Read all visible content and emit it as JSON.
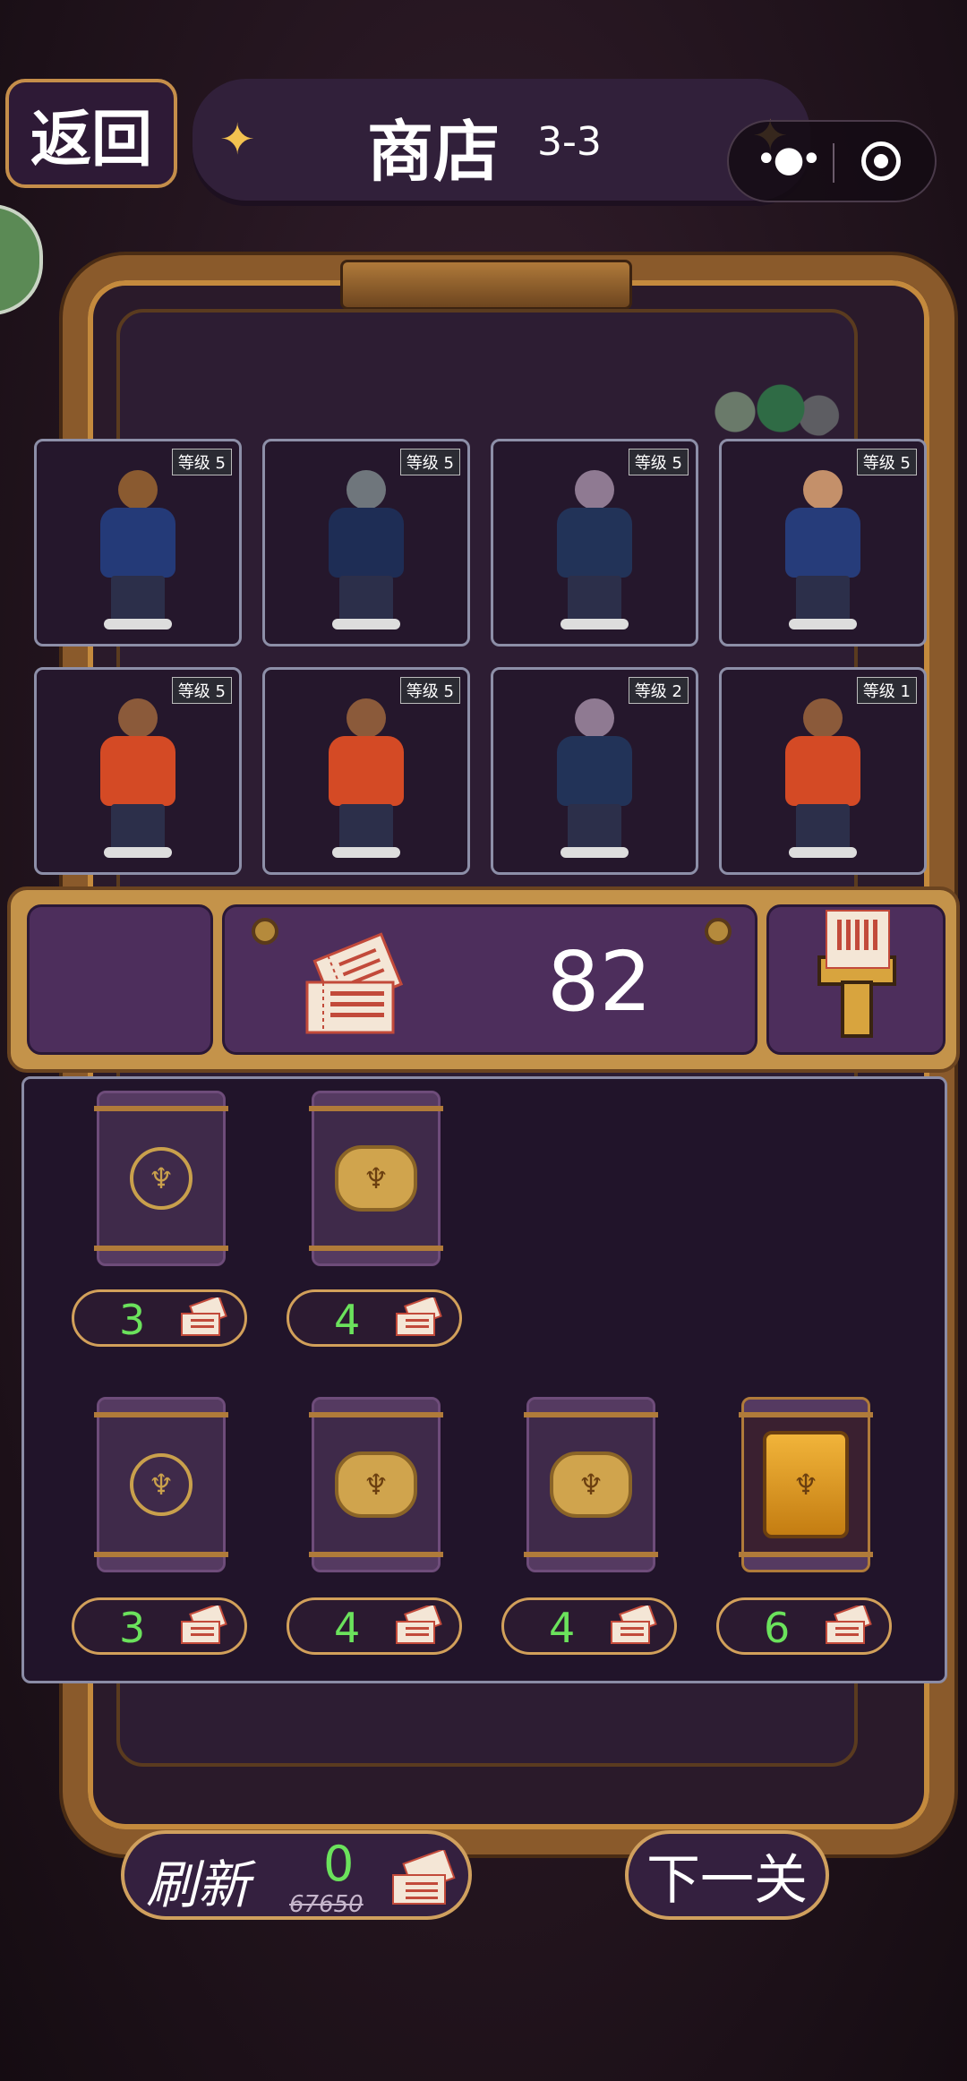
{
  "header": {
    "back_label": "返回",
    "title": "商店",
    "level": "3-3"
  },
  "characters": [
    {
      "level": "等级 5",
      "species": "eagle",
      "jacket": "#243a78"
    },
    {
      "level": "等级 5",
      "species": "seal",
      "jacket": "#1e2d55"
    },
    {
      "level": "等级 5",
      "species": "hippo",
      "jacket": "#223358"
    },
    {
      "level": "等级 5",
      "species": "snake",
      "jacket": "#263c7a"
    },
    {
      "level": "等级 5",
      "species": "monkey",
      "jacket": "#d44a25"
    },
    {
      "level": "等级 5",
      "species": "monkey",
      "jacket": "#d44a25"
    },
    {
      "level": "等级 2",
      "species": "hippo",
      "jacket": "#223358"
    },
    {
      "level": "等级 1",
      "species": "monkey",
      "jacket": "#d44a25"
    }
  ],
  "tickets": {
    "count": "82"
  },
  "packs": [
    {
      "price": "3",
      "tier": "basic"
    },
    {
      "price": "4",
      "tier": "silver"
    },
    {
      "price": "3",
      "tier": "basic"
    },
    {
      "price": "4",
      "tier": "silver"
    },
    {
      "price": "4",
      "tier": "silver"
    },
    {
      "price": "6",
      "tier": "gold"
    }
  ],
  "footer": {
    "refresh_label": "刷新",
    "refresh_cost": "0",
    "refresh_old": "67650",
    "next_label": "下一关"
  },
  "colors": {
    "accent_gold": "#d0a05e",
    "price_green": "#6be25c",
    "panel_purple": "#4d2e5c"
  }
}
